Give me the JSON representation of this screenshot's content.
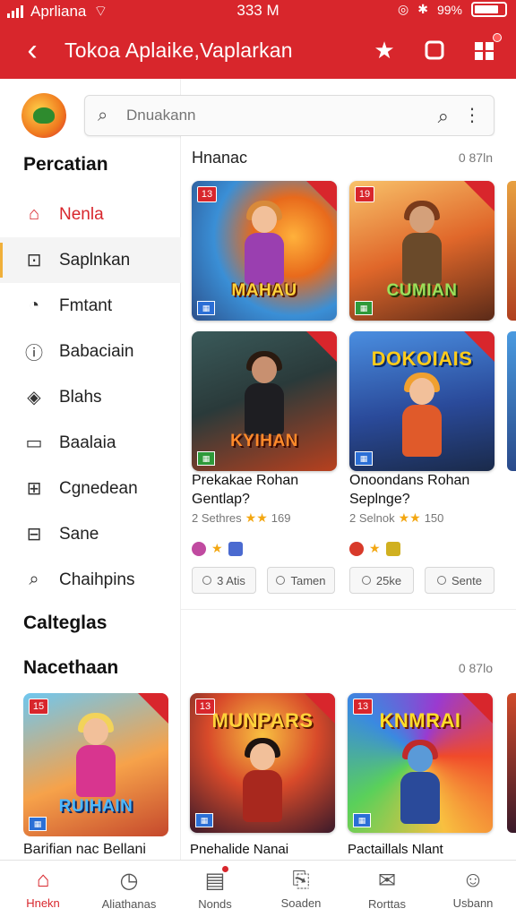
{
  "status": {
    "carrier": "Aprliana",
    "time": "333 M",
    "battery": "99%"
  },
  "appbar": {
    "title": "Tokoa Aplaike,Vaplarkan"
  },
  "search": {
    "placeholder": "Dnuakann"
  },
  "sidebar": {
    "section1": "Percatian",
    "items": [
      {
        "label": "Nenla",
        "icon": "home-icon"
      },
      {
        "label": "Saplnkan",
        "icon": "download-icon"
      },
      {
        "label": "Fmtant",
        "icon": "circle-arrow-icon"
      },
      {
        "label": "Babaciain",
        "icon": "info-icon"
      },
      {
        "label": "Blahs",
        "icon": "pin-icon"
      },
      {
        "label": "Baalaia",
        "icon": "folder-icon"
      },
      {
        "label": "Cgnedean",
        "icon": "lock-icon"
      },
      {
        "label": "Sane",
        "icon": "box-icon"
      },
      {
        "label": "Chaihpins",
        "icon": "search-icon"
      }
    ],
    "section2": "Calteglas",
    "section3": "Nacethaan",
    "card": {
      "badge": "15",
      "game_title": "RUIHAIN",
      "title": "Barifian nac Bellani"
    }
  },
  "main": {
    "section1": {
      "title": "Hnanac",
      "meta": "0 87ln"
    },
    "section2": {
      "meta": "0 87lo"
    },
    "cards": [
      {
        "badge": "13",
        "game_title": "MAHAU"
      },
      {
        "badge": "19",
        "game_title": "CUMIAN"
      },
      {
        "game_title": "KYIHAN"
      },
      {
        "game_title": "DOKOIAIS"
      }
    ],
    "details": [
      {
        "title": "Prekakae Rohan",
        "subtitle": "Gentlap?",
        "rating": "2 Sethres",
        "count": "169"
      },
      {
        "title": "Onoondans Rohan",
        "subtitle": "Seplnge?",
        "rating": "2 Selnok",
        "count": "150"
      }
    ],
    "pills": [
      "3 Atis",
      "Tamen",
      "25ke",
      "Sente"
    ],
    "cards2": [
      {
        "badge": "13",
        "game_title": "MUNPARS",
        "title": "Pnehalide Nanai"
      },
      {
        "badge": "13",
        "game_title": "KNMRAI",
        "title": "Pactaillals Nlant"
      }
    ]
  },
  "bottom_nav": [
    {
      "label": "Hnekn",
      "icon": "home-icon"
    },
    {
      "label": "Aliathanas",
      "icon": "clock-icon"
    },
    {
      "label": "Nonds",
      "icon": "book-icon"
    },
    {
      "label": "Soaden",
      "icon": "share-icon"
    },
    {
      "label": "Rorttas",
      "icon": "mail-icon"
    },
    {
      "label": "Usbann",
      "icon": "user-icon"
    }
  ]
}
